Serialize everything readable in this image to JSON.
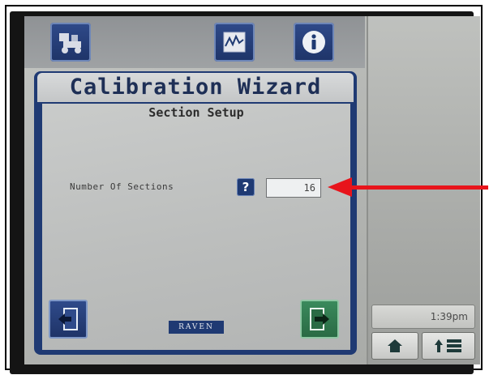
{
  "wizard": {
    "title": "Calibration Wizard",
    "subtitle": "Section Setup",
    "field_label": "Number Of Sections",
    "help_label": "?",
    "sections_value": "16",
    "brand": "RAVEN"
  },
  "status": {
    "time": "1:39pm"
  },
  "colors": {
    "panel_blue": "#1f3a73",
    "next_green": "#2a6b44",
    "annotation_red": "#e8141b"
  },
  "icons": {
    "top": [
      "machine-setup-icon",
      "performance-chart-icon",
      "info-icon"
    ],
    "nav": [
      "back-arrow-icon",
      "next-arrow-icon"
    ],
    "bottom": [
      "home-icon",
      "menu-grid-icon"
    ]
  }
}
